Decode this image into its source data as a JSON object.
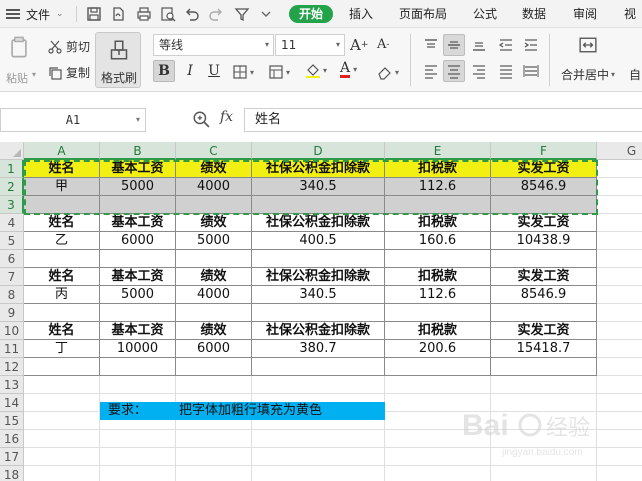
{
  "menu": {
    "file_label": "文件",
    "tabs": [
      {
        "label": "开始",
        "active": true
      },
      {
        "label": "插入",
        "active": false
      },
      {
        "label": "页面布局",
        "active": false
      },
      {
        "label": "公式",
        "active": false
      },
      {
        "label": "数据",
        "active": false
      },
      {
        "label": "审阅",
        "active": false
      },
      {
        "label": "视",
        "active": false
      }
    ]
  },
  "ribbon": {
    "paste": "粘贴",
    "cut": "剪切",
    "copy": "复制",
    "format_painter": "格式刷",
    "font_name": "等线",
    "font_size": "11",
    "merge_center": "合并居中",
    "auto_wrap": "自"
  },
  "formula_bar": {
    "name_box": "A1",
    "fx": "fx",
    "value": "姓名"
  },
  "sheet": {
    "columns": [
      "A",
      "B",
      "C",
      "D",
      "E",
      "F",
      "G"
    ],
    "rows": [
      "1",
      "2",
      "3",
      "4",
      "5",
      "6",
      "7",
      "8",
      "9",
      "10",
      "11",
      "12",
      "13",
      "14",
      "15",
      "16",
      "17",
      "18"
    ],
    "headers": [
      "姓名",
      "基本工资",
      "绩效",
      "社保公积金扣除款",
      "扣税款",
      "实发工资"
    ],
    "records": [
      [
        "甲",
        "5000",
        "4000",
        "340.5",
        "112.6",
        "8546.9"
      ],
      [
        "乙",
        "6000",
        "5000",
        "400.5",
        "160.6",
        "10438.9"
      ],
      [
        "丙",
        "5000",
        "4000",
        "340.5",
        "112.6",
        "8546.9"
      ],
      [
        "丁",
        "10000",
        "6000",
        "380.7",
        "200.6",
        "15418.7"
      ]
    ],
    "note_label": "要求：",
    "note_text": "把字体加粗行填充为黄色",
    "colors": {
      "header_fill": "#f2ef12",
      "selection_fill": "#d0d0d0",
      "note_fill": "#00b0f0",
      "accent": "#22a34a"
    }
  },
  "watermark": {
    "brand": "Bai",
    "sub": "经验",
    "url": "jingyan.baidu.com"
  }
}
